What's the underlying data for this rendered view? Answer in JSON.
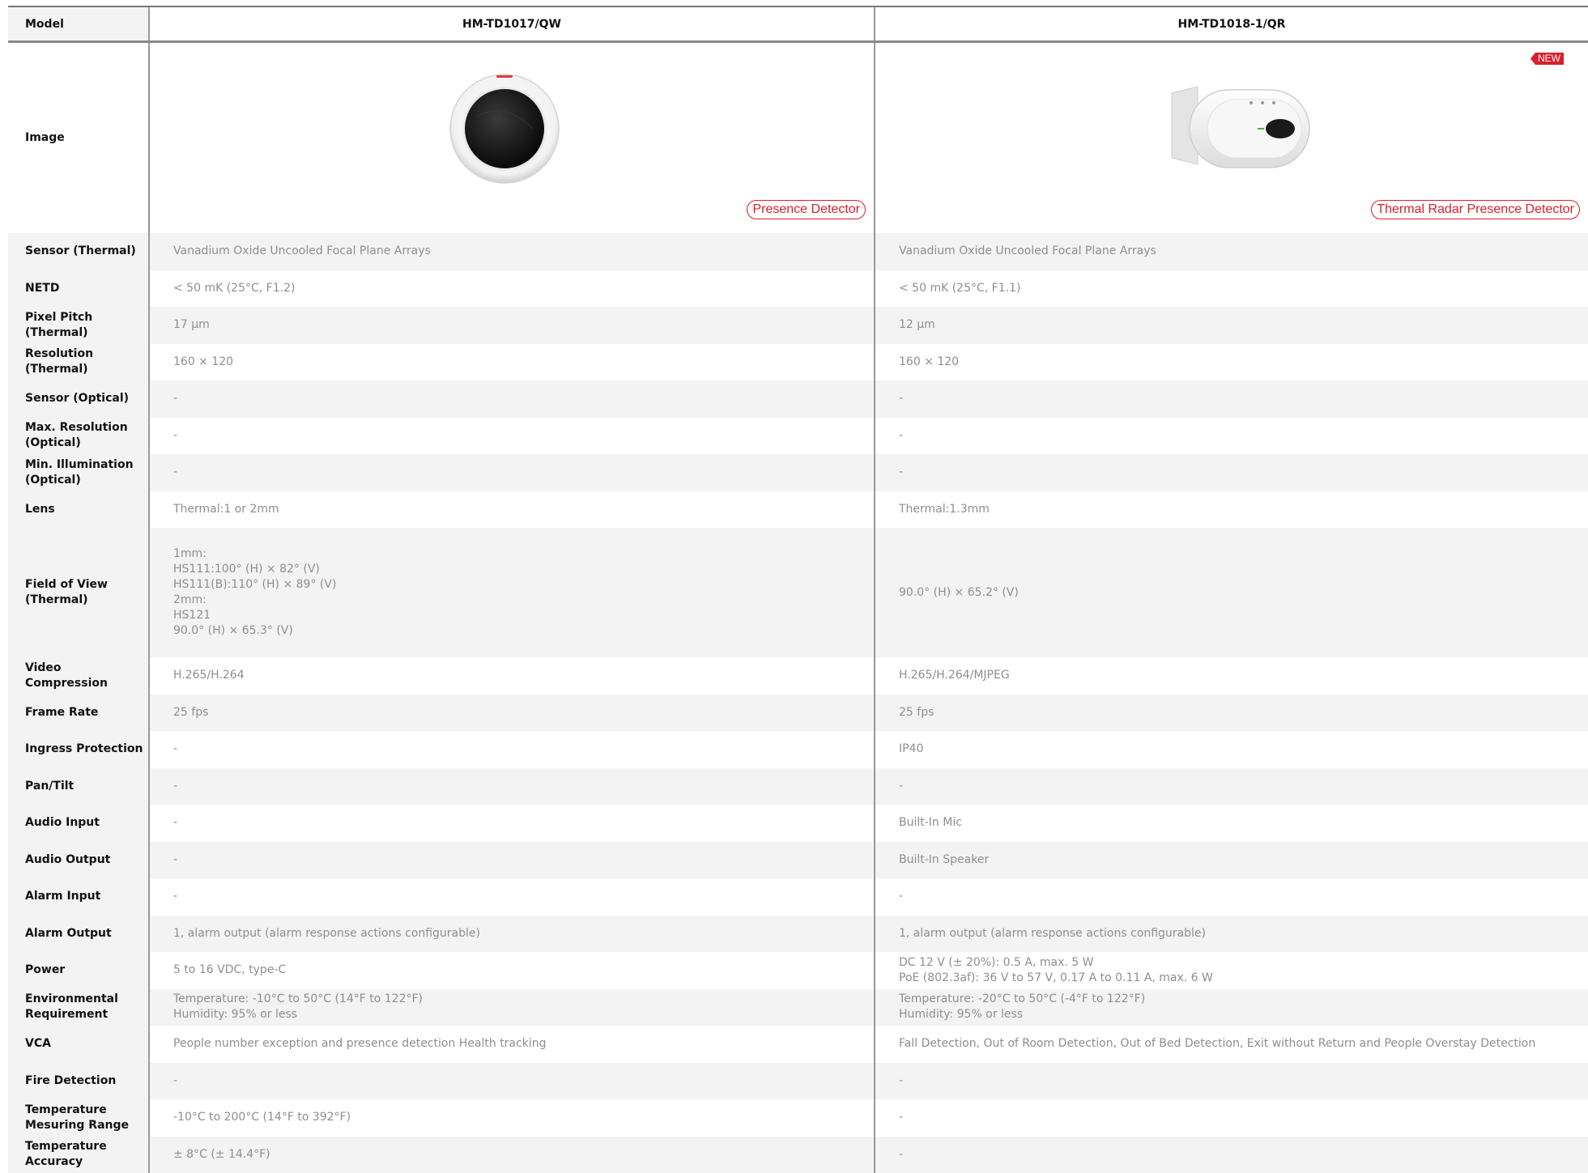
{
  "header": {
    "label": "Model",
    "models": [
      "HM-TD1017/QW",
      "HM-TD1018-1/QR"
    ]
  },
  "image_row": {
    "label": "Image",
    "products": [
      {
        "tag": "Presence Detector",
        "badge": "",
        "icon": "round-thermal-detector"
      },
      {
        "tag": "Thermal Radar Presence Detector",
        "badge": "NEW",
        "icon": "oval-wall-detector"
      }
    ]
  },
  "colors": {
    "accent": "#d8202a",
    "label_bg": "#f3f3f3",
    "value_text": "#8e8e8e"
  },
  "rows": [
    {
      "label": "Sensor (Thermal)",
      "a": "Vanadium Oxide Uncooled Focal Plane Arrays",
      "b": "Vanadium Oxide Uncooled Focal Plane Arrays"
    },
    {
      "label": "NETD",
      "a": "< 50 mK (25°C, F1.2)",
      "b": "< 50 mK (25°C, F1.1)"
    },
    {
      "label": "Pixel Pitch (Thermal)",
      "a": "17 μm",
      "b": "12 μm"
    },
    {
      "label": "Resolution (Thermal)",
      "a": "160 × 120",
      "b": "160 × 120"
    },
    {
      "label": "Sensor (Optical)",
      "a": "-",
      "b": "-"
    },
    {
      "label": "Max. Resolution (Optical)",
      "a": "-",
      "b": "-"
    },
    {
      "label": "Min. Illumination (Optical)",
      "a": "-",
      "b": "-"
    },
    {
      "label": "Lens",
      "a": "Thermal:1 or 2mm",
      "b": "Thermal:1.3mm"
    },
    {
      "label": "Field of View (Thermal)",
      "a": "1mm:\nHS111:100° (H) × 82° (V)\nHS111(B):110° (H) × 89° (V)\n2mm:\nHS121\n90.0° (H) × 65.3° (V)",
      "b": "90.0° (H) × 65.2° (V)"
    },
    {
      "label": "Video Compression",
      "a": "H.265/H.264",
      "b": "H.265/H.264/MJPEG"
    },
    {
      "label": "Frame Rate",
      "a": "25 fps",
      "b": "25 fps"
    },
    {
      "label": "Ingress Protection",
      "a": "-",
      "b": "IP40"
    },
    {
      "label": "Pan/Tilt",
      "a": "-",
      "b": "-"
    },
    {
      "label": "Audio Input",
      "a": "-",
      "b": "Built-In Mic"
    },
    {
      "label": "Audio Output",
      "a": "-",
      "b": "Built-In Speaker"
    },
    {
      "label": "Alarm Input",
      "a": "-",
      "b": "-"
    },
    {
      "label": "Alarm Output",
      "a": "1, alarm output (alarm response actions configurable)",
      "b": "1, alarm output (alarm response actions configurable)"
    },
    {
      "label": "Power",
      "a": "5 to 16 VDC, type-C",
      "b": "DC 12 V (± 20%): 0.5 A, max. 5 W\nPoE (802.3af): 36 V to 57 V, 0.17 A to 0.11 A, max. 6 W"
    },
    {
      "label": "Environmental Requirement",
      "a": "Temperature: -10°C to 50°C (14°F to 122°F)\nHumidity: 95% or less",
      "b": "Temperature: -20°C to 50°C (-4°F to 122°F)\nHumidity: 95% or less"
    },
    {
      "label": "VCA",
      "a": "People number exception and presence detection Health tracking",
      "b": "Fall Detection, Out of Room Detection, Out of Bed Detection, Exit without Return and People Overstay Detection"
    },
    {
      "label": "Fire Detection",
      "a": "-",
      "b": "-"
    },
    {
      "label": "Temperature Mesuring Range",
      "a": " -10°C to 200°C (14°F to 392°F)",
      "b": "-"
    },
    {
      "label": "Temperature Accuracy",
      "a": "± 8°C (± 14.4°F)",
      "b": "-"
    }
  ]
}
